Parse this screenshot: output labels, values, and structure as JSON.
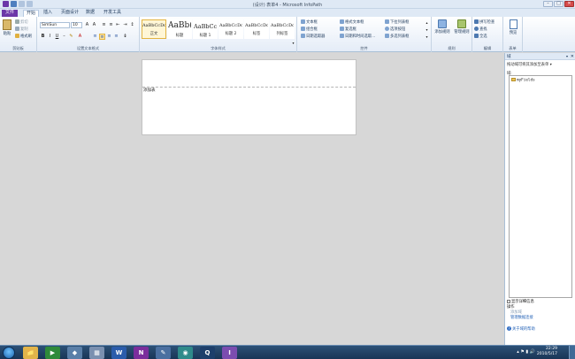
{
  "window": {
    "title": "(设计) 表单4 - Microsoft InfoPath",
    "controls": {
      "minimize": "–",
      "maximize": "□",
      "close": "✕"
    }
  },
  "tabs": [
    "文件",
    "开始",
    "插入",
    "页面设计",
    "数据",
    "开发工具"
  ],
  "ribbon": {
    "clipboard": {
      "label": "剪贴板",
      "paste": "粘贴",
      "cut": "剪切",
      "copy": "复制",
      "format_painter": "格式刷"
    },
    "font": {
      "label": "设置文本格式",
      "font_name": "SimSun",
      "font_size": "10",
      "bold": "B",
      "italic": "I",
      "underline": "U"
    },
    "styles": {
      "label": "字体样式",
      "items": [
        {
          "sample": "AaBbCcDd",
          "name": "正文"
        },
        {
          "sample": "AaBb(",
          "name": "标题"
        },
        {
          "sample": "AaBbCcI",
          "name": "标题 1"
        },
        {
          "sample": "AaBbCcDd",
          "name": "标题 2"
        },
        {
          "sample": "AaBbCcDd",
          "name": "标签"
        },
        {
          "sample": "AaBbCcDd",
          "name": "列标签"
        }
      ]
    },
    "controls": {
      "label": "控件",
      "col1": [
        "文本框",
        "组合框",
        "日期选取器"
      ],
      "col2": [
        "格式文本框",
        "复选框",
        "日期和时间选取..."
      ],
      "col3": [
        "下拉列表框",
        "选项按钮",
        "多选列表框"
      ]
    },
    "rules": {
      "label": "规则",
      "add_rule": "添加规则",
      "manage_rules": "管理规则"
    },
    "editing": {
      "label": "编辑",
      "spelling": "拼写检查",
      "find": "查找",
      "select_all": "全选"
    },
    "form": {
      "label": "表单",
      "preview": "预览"
    }
  },
  "document": {
    "table_label": "添加表"
  },
  "fields_pane": {
    "title": "域",
    "close": "✕",
    "dropdown": "▾",
    "hint": "拖动域可将其添加至表单 ▾",
    "fields_label": "域:",
    "tree": [
      {
        "name": "myFields"
      }
    ],
    "show_details": "显示详细信息",
    "actions_label": "操作",
    "add_field": "添加域",
    "manage_connections": "管理数据连接",
    "help": "关于域的帮助"
  },
  "taskbar": {
    "time": "22:29",
    "date": "2010/5/17",
    "apps": [
      {
        "name": "explorer",
        "label": "📁",
        "color": "#e2b44a"
      },
      {
        "name": "media",
        "label": "▶",
        "color": "#2f8a3a"
      },
      {
        "name": "app3",
        "label": "◆",
        "color": "#5a7fa8"
      },
      {
        "name": "app4",
        "label": "▦",
        "color": "#7a90b0"
      },
      {
        "name": "word",
        "label": "W",
        "color": "#2b5cab"
      },
      {
        "name": "onenote",
        "label": "N",
        "color": "#7b2e9c"
      },
      {
        "name": "app7",
        "label": "✎",
        "color": "#4a6fa0"
      },
      {
        "name": "app8",
        "label": "◉",
        "color": "#2f8a8a"
      },
      {
        "name": "qq",
        "label": "Q",
        "color": "#1d3f6b"
      },
      {
        "name": "infopath",
        "label": "I",
        "color": "#7b4db0"
      }
    ]
  }
}
